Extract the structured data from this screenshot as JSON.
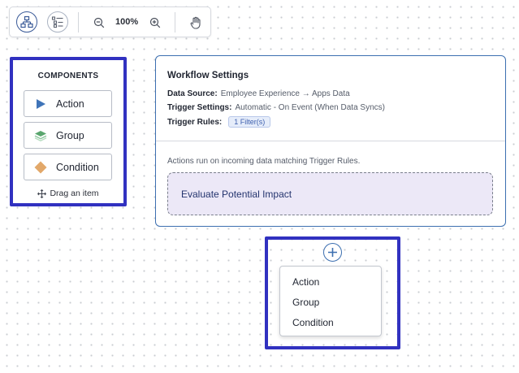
{
  "toolbar": {
    "zoom_level": "100%"
  },
  "components": {
    "title": "COMPONENTS",
    "items": [
      {
        "label": "Action",
        "icon": "play-triangle-icon"
      },
      {
        "label": "Group",
        "icon": "layers-icon"
      },
      {
        "label": "Condition",
        "icon": "diamond-icon"
      }
    ],
    "drag_hint": "Drag an item"
  },
  "workflow": {
    "title": "Workflow Settings",
    "data_source_label": "Data Source:",
    "data_source_value": "Employee Experience → Apps Data",
    "trigger_settings_label": "Trigger Settings:",
    "trigger_settings_value": "Automatic - On Event (When Data Syncs)",
    "trigger_rules_label": "Trigger Rules:",
    "trigger_rules_badge": "1 Filter(s)",
    "note": "Actions run on incoming data matching Trigger Rules.",
    "step_label": "Evaluate Potential Impact"
  },
  "add_menu": {
    "items": [
      "Action",
      "Group",
      "Condition"
    ]
  },
  "colors": {
    "accent": "#3c6fb0",
    "highlight": "#3131c0",
    "action_icon": "#3f74b8",
    "group_icon": "#5aa66e",
    "condition_icon": "#e2a86a",
    "step_bg": "#ece8f7"
  }
}
